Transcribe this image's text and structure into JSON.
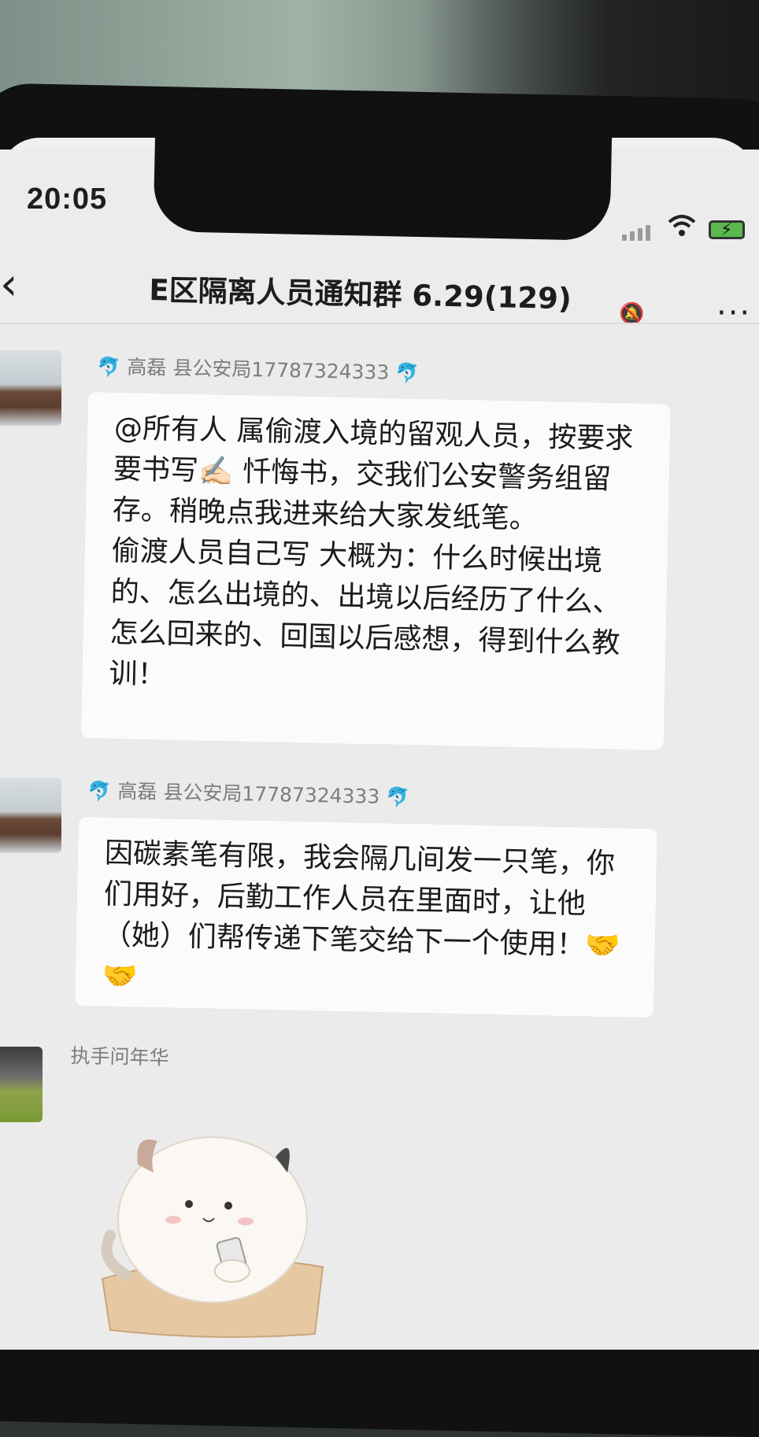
{
  "status_bar": {
    "time": "20:05"
  },
  "nav": {
    "back_icon": "chevron-left-icon",
    "title": "E区隔离人员通知群 6.29(129)",
    "mute_icon": "bell-mute-icon",
    "more_icon": "more-dots-icon",
    "more_glyph": "···"
  },
  "messages": [
    {
      "sender_name": "高磊",
      "sender_title": "县公安局17787324333",
      "paragraphs": [
        "@所有人  属偷渡入境的留观人员，按要求要书写✍🏻 忏悔书，交我们公安警务组留存。稍晚点我进来给大家发纸笔。",
        "偷渡人员自己写  大概为：什么时候出境的、怎么出境的、出境以后经历了什么、怎么回来的、回国以后感想，得到什么教训！"
      ]
    },
    {
      "sender_name": "高磊",
      "sender_title": "县公安局17787324333",
      "paragraphs": [
        "因碳素笔有限，我会隔几间发一只笔，你们用好，后勤工作人员在里面时，让他（她）们帮传递下笔交给下一个使用！🤝🤝"
      ]
    },
    {
      "sender_name": "执手问年华",
      "sticker": "cat-sticker"
    }
  ],
  "colors": {
    "chat_background": "#ebebeb",
    "bubble_background": "#fbfbfb",
    "sender_text": "#7d7d7d",
    "battery": "#5ab84d"
  }
}
